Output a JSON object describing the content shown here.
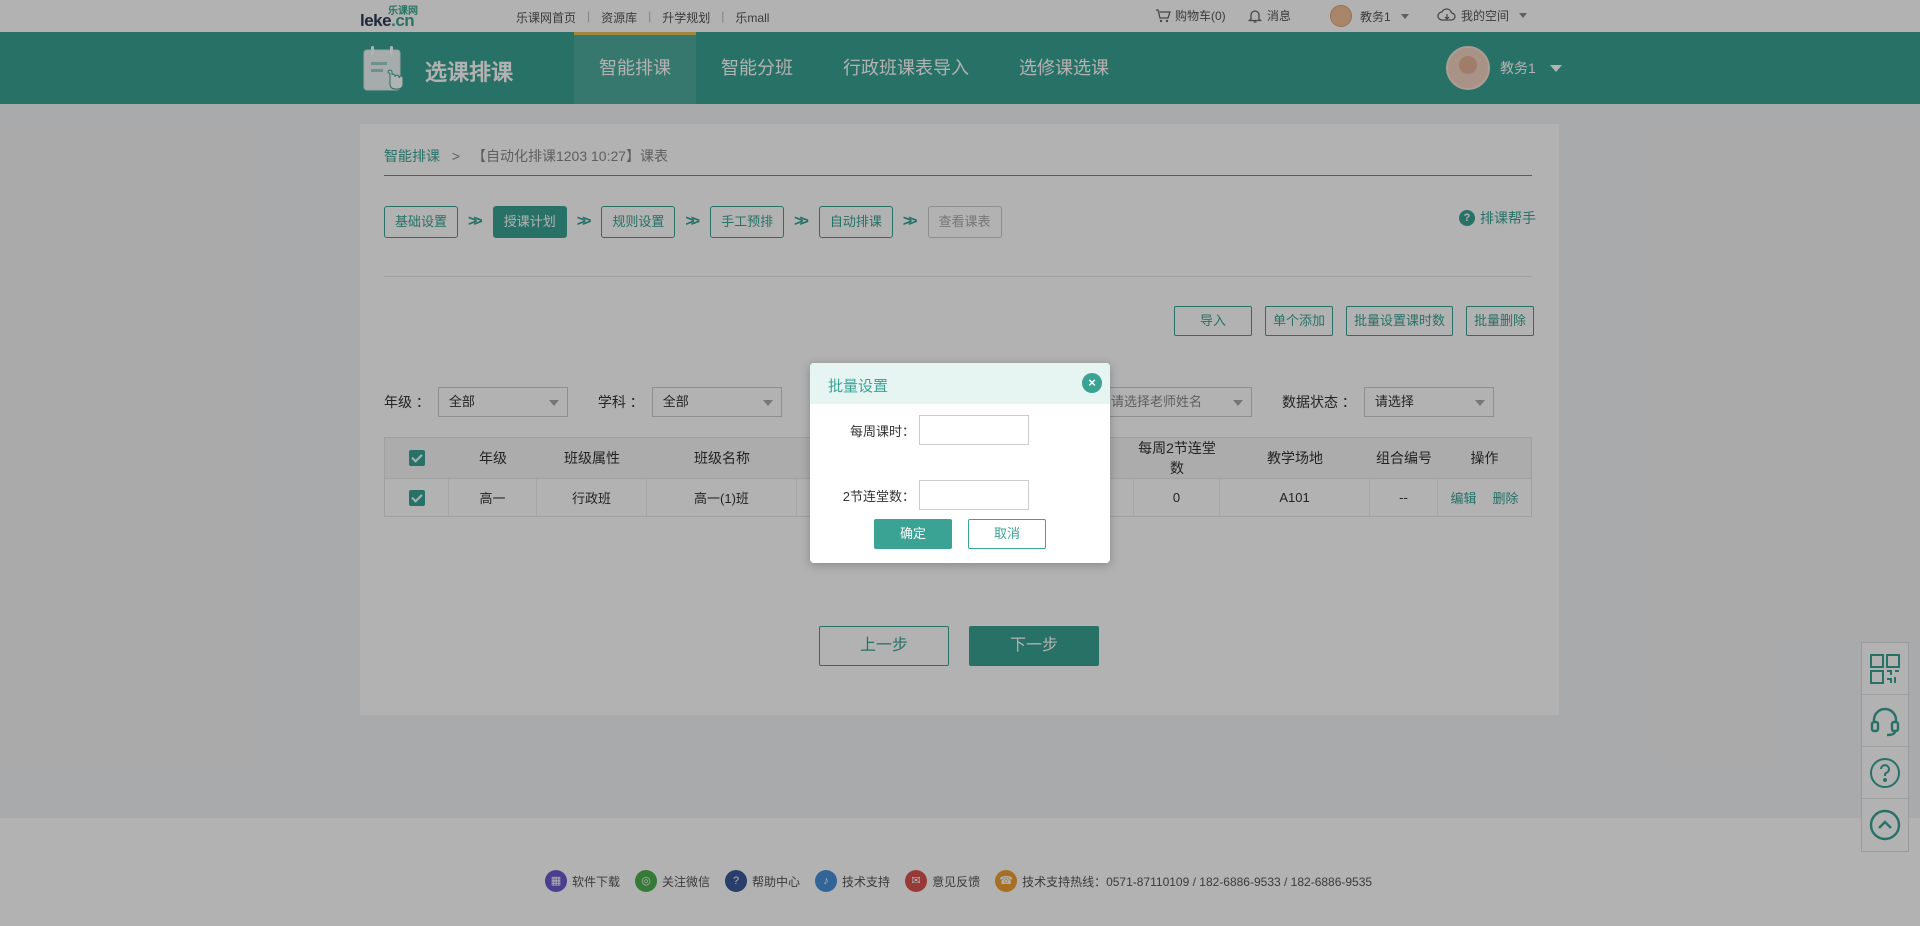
{
  "topbar": {
    "logo_text_top": "乐课网",
    "logo_text_main": "leke",
    "logo_text_suffix": ".cn",
    "links": [
      "乐课网首页",
      "资源库",
      "升学规划",
      "乐mall"
    ],
    "cart": "购物车(0)",
    "messages": "消息",
    "user": "教务1",
    "space": "我的空间"
  },
  "header": {
    "app_title": "选课排课",
    "nav": [
      {
        "label": "智能排课",
        "active": true
      },
      {
        "label": "智能分班",
        "active": false
      },
      {
        "label": "行政班课表导入",
        "active": false
      },
      {
        "label": "选修课选课",
        "active": false
      }
    ],
    "user_name": "教务1"
  },
  "breadcrumb": {
    "root": "智能排课",
    "separator": ">",
    "current": "【自动化排课1203 10:27】课表"
  },
  "steps": [
    {
      "label": "基础设置",
      "state": "done"
    },
    {
      "label": "授课计划",
      "state": "active"
    },
    {
      "label": "规则设置",
      "state": "done"
    },
    {
      "label": "手工预排",
      "state": "done"
    },
    {
      "label": "自动排课",
      "state": "done"
    },
    {
      "label": "查看课表",
      "state": "disabled"
    }
  ],
  "helper": "排课帮手",
  "actions": [
    "导入",
    "单个添加",
    "批量设置课时数",
    "批量删除"
  ],
  "filters": {
    "grade_label": "年级 ：",
    "grade_value": "全部",
    "subject_label": "学科 ：",
    "subject_value": "全部",
    "teacher_placeholder": "请选择老师姓名",
    "status_label": "数据状态 ：",
    "status_value": "请选择"
  },
  "table": {
    "headers": [
      "年级",
      "班级属性",
      "班级名称",
      "每周2节连堂数",
      "教学场地",
      "组合编号",
      "操作"
    ],
    "rows": [
      {
        "grade": "高一",
        "class_type": "行政班",
        "class_name": "高一(1)班",
        "double": "0",
        "room": "A101",
        "combo": "--",
        "edit": "编辑",
        "delete": "删除"
      }
    ]
  },
  "pager": {
    "prev": "上一步",
    "next": "下一步"
  },
  "modal": {
    "title": "批量设置",
    "weekly_label": "每周课时：",
    "double_label": "2节连堂数：",
    "ok": "确定",
    "cancel": "取消"
  },
  "footer": {
    "links": [
      {
        "label": "软件下载",
        "color": "#6a5acd"
      },
      {
        "label": "关注微信",
        "color": "#4caf50"
      },
      {
        "label": "帮助中心",
        "color": "#3b5998"
      },
      {
        "label": "技术支持",
        "color": "#4a90d9"
      },
      {
        "label": "意见反馈",
        "color": "#d9534f"
      }
    ],
    "hotline": "技术支持热线：0571-87110109 / 182-6886-9533 / 182-6886-9535"
  },
  "side_toolbar": [
    "qrcode-icon",
    "headset-icon",
    "help-icon",
    "back-to-top-icon"
  ],
  "colors": {
    "primary": "#3aa394",
    "accent": "#e8c35a"
  }
}
